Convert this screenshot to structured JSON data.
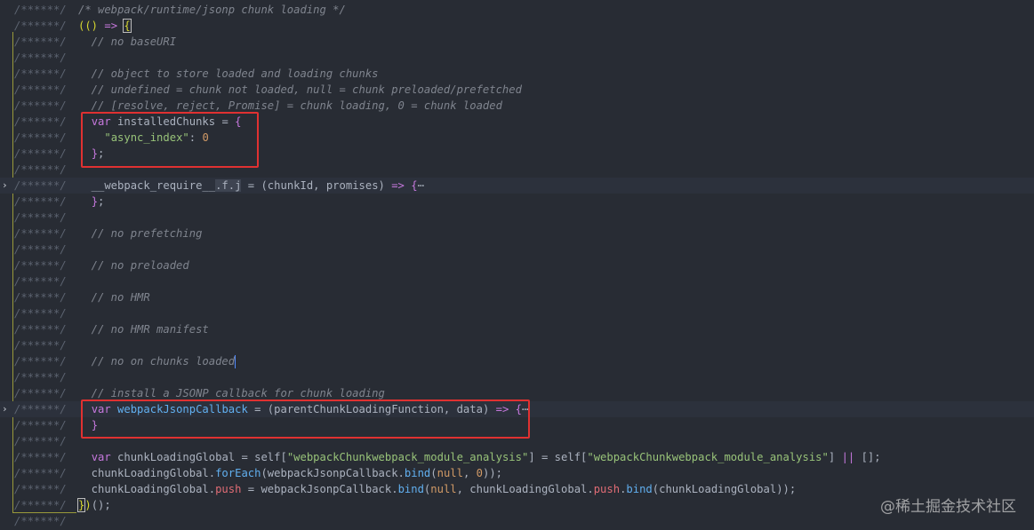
{
  "editor": {
    "gutter_marker": "/******/",
    "lines": [
      {
        "gutter": "/******/ ",
        "tokens": [
          {
            "t": "/* webpack/runtime/jsonp chunk loading */",
            "c": "cm"
          }
        ]
      },
      {
        "gutter": "/******/ ",
        "tokens": [
          {
            "t": "(() ",
            "c": "bkt"
          },
          {
            "t": "=>",
            "c": "kw"
          },
          {
            "t": " ",
            "c": "pl"
          },
          {
            "t": "{",
            "c": "bkt-box"
          }
        ]
      },
      {
        "gutter": "/******/ ",
        "tokens": [
          {
            "t": "  // no baseURI",
            "c": "cm"
          }
        ]
      },
      {
        "gutter": "/******/ ",
        "tokens": []
      },
      {
        "gutter": "/******/ ",
        "tokens": [
          {
            "t": "  // object to store loaded and loading chunks",
            "c": "cm"
          }
        ]
      },
      {
        "gutter": "/******/ ",
        "tokens": [
          {
            "t": "  // undefined = chunk not loaded, null = chunk preloaded/prefetched",
            "c": "cm"
          }
        ]
      },
      {
        "gutter": "/******/ ",
        "tokens": [
          {
            "t": "  // [resolve, reject, Promise] = chunk loading, 0 = chunk loaded",
            "c": "cm"
          }
        ]
      },
      {
        "gutter": "/******/ ",
        "tokens": [
          {
            "t": "  ",
            "c": "pl"
          },
          {
            "t": "var",
            "c": "kw"
          },
          {
            "t": " installedChunks = ",
            "c": "pl"
          },
          {
            "t": "{",
            "c": "kw"
          }
        ]
      },
      {
        "gutter": "/******/ ",
        "tokens": [
          {
            "t": "    ",
            "c": "pl"
          },
          {
            "t": "\"async_index\"",
            "c": "str"
          },
          {
            "t": ": ",
            "c": "pl"
          },
          {
            "t": "0",
            "c": "num"
          }
        ]
      },
      {
        "gutter": "/******/ ",
        "tokens": [
          {
            "t": "  ",
            "c": "pl"
          },
          {
            "t": "}",
            "c": "kw"
          },
          {
            "t": ";",
            "c": "pl"
          }
        ]
      },
      {
        "gutter": "/******/ ",
        "tokens": []
      },
      {
        "gutter": "/******/ ",
        "fold": true,
        "highlight": true,
        "tokens": [
          {
            "t": "  __webpack_require__",
            "c": "pl"
          },
          {
            "t": ".f.j",
            "c": "sel"
          },
          {
            "t": " = (chunkId, promises) ",
            "c": "pl"
          },
          {
            "t": "=>",
            "c": "kw"
          },
          {
            "t": " ",
            "c": "pl"
          },
          {
            "t": "{",
            "c": "kw"
          },
          {
            "t": "⋯",
            "c": "fold-ell"
          }
        ]
      },
      {
        "gutter": "/******/ ",
        "tokens": [
          {
            "t": "  ",
            "c": "pl"
          },
          {
            "t": "}",
            "c": "kw"
          },
          {
            "t": ";",
            "c": "pl"
          }
        ]
      },
      {
        "gutter": "/******/ ",
        "tokens": []
      },
      {
        "gutter": "/******/ ",
        "tokens": [
          {
            "t": "  // no prefetching",
            "c": "cm"
          }
        ]
      },
      {
        "gutter": "/******/ ",
        "tokens": []
      },
      {
        "gutter": "/******/ ",
        "tokens": [
          {
            "t": "  // no preloaded",
            "c": "cm"
          }
        ]
      },
      {
        "gutter": "/******/ ",
        "tokens": []
      },
      {
        "gutter": "/******/ ",
        "tokens": [
          {
            "t": "  // no HMR",
            "c": "cm"
          }
        ]
      },
      {
        "gutter": "/******/ ",
        "tokens": []
      },
      {
        "gutter": "/******/ ",
        "tokens": [
          {
            "t": "  // no HMR manifest",
            "c": "cm"
          }
        ]
      },
      {
        "gutter": "/******/ ",
        "tokens": []
      },
      {
        "gutter": "/******/ ",
        "cursor": true,
        "tokens": [
          {
            "t": "  // no on chunks loaded",
            "c": "cm"
          }
        ]
      },
      {
        "gutter": "/******/ ",
        "tokens": []
      },
      {
        "gutter": "/******/ ",
        "tokens": [
          {
            "t": "  // install a JSONP callback for chunk loading",
            "c": "cm"
          }
        ]
      },
      {
        "gutter": "/******/ ",
        "fold": true,
        "highlight": true,
        "tokens": [
          {
            "t": "  ",
            "c": "pl"
          },
          {
            "t": "var",
            "c": "kw"
          },
          {
            "t": " ",
            "c": "pl"
          },
          {
            "t": "webpackJsonpCallback",
            "c": "fn"
          },
          {
            "t": " = (parentChunkLoadingFunction, data) ",
            "c": "pl"
          },
          {
            "t": "=>",
            "c": "kw"
          },
          {
            "t": " ",
            "c": "pl"
          },
          {
            "t": "{",
            "c": "kw"
          },
          {
            "t": "⋯",
            "c": "fold-ell"
          }
        ]
      },
      {
        "gutter": "/******/ ",
        "tokens": [
          {
            "t": "  ",
            "c": "pl"
          },
          {
            "t": "}",
            "c": "kw"
          }
        ]
      },
      {
        "gutter": "/******/ ",
        "tokens": []
      },
      {
        "gutter": "/******/ ",
        "tokens": [
          {
            "t": "  ",
            "c": "pl"
          },
          {
            "t": "var",
            "c": "kw"
          },
          {
            "t": " chunkLoadingGlobal = self[",
            "c": "pl"
          },
          {
            "t": "\"webpackChunkwebpack_module_analysis\"",
            "c": "str"
          },
          {
            "t": "] = self[",
            "c": "pl"
          },
          {
            "t": "\"webpackChunkwebpack_module_analysis\"",
            "c": "str"
          },
          {
            "t": "] ",
            "c": "pl"
          },
          {
            "t": "||",
            "c": "kw"
          },
          {
            "t": " [];",
            "c": "pl"
          }
        ]
      },
      {
        "gutter": "/******/ ",
        "tokens": [
          {
            "t": "  chunkLoadingGlobal.",
            "c": "pl"
          },
          {
            "t": "forEach",
            "c": "fn"
          },
          {
            "t": "(webpackJsonpCallback.",
            "c": "pl"
          },
          {
            "t": "bind",
            "c": "fn"
          },
          {
            "t": "(",
            "c": "pl"
          },
          {
            "t": "null",
            "c": "num"
          },
          {
            "t": ", ",
            "c": "pl"
          },
          {
            "t": "0",
            "c": "num"
          },
          {
            "t": "));",
            "c": "pl"
          }
        ]
      },
      {
        "gutter": "/******/ ",
        "tokens": [
          {
            "t": "  chunkLoadingGlobal.",
            "c": "pl"
          },
          {
            "t": "push",
            "c": "prop"
          },
          {
            "t": " = webpackJsonpCallback.",
            "c": "pl"
          },
          {
            "t": "bind",
            "c": "fn"
          },
          {
            "t": "(",
            "c": "pl"
          },
          {
            "t": "null",
            "c": "num"
          },
          {
            "t": ", chunkLoadingGlobal.",
            "c": "pl"
          },
          {
            "t": "push",
            "c": "prop"
          },
          {
            "t": ".",
            "c": "pl"
          },
          {
            "t": "bind",
            "c": "fn"
          },
          {
            "t": "(chunkLoadingGlobal));",
            "c": "pl"
          }
        ]
      },
      {
        "gutter": "/******/ ",
        "tokens": [
          {
            "t": "}",
            "c": "bkt-box"
          },
          {
            "t": ")",
            "c": "bkt"
          },
          {
            "t": "();",
            "c": "pl"
          }
        ]
      },
      {
        "gutter": "/******/ ",
        "tokens": []
      }
    ]
  },
  "annotations": [
    {
      "name": "installed-chunks-highlight"
    },
    {
      "name": "jsonp-callback-highlight"
    }
  ],
  "watermark": "@稀土掘金技术社区",
  "colors": {
    "background": "#282c34",
    "comment": "#7f848e",
    "keyword": "#c678dd",
    "function": "#61afef",
    "string": "#98c379",
    "number": "#d19a66",
    "annotation": "#e03131"
  }
}
